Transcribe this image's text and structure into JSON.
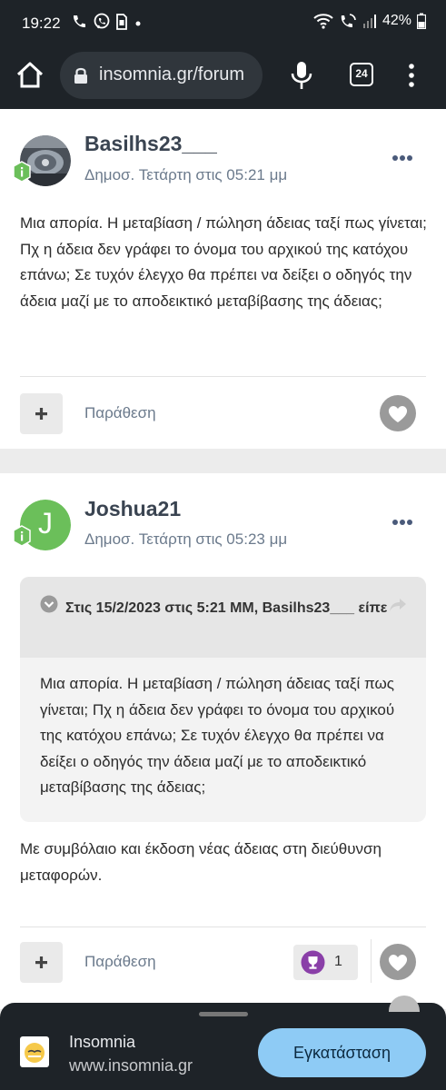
{
  "status_bar": {
    "time": "19:22",
    "battery": "42%"
  },
  "browser": {
    "url": "insomnia.gr/forum",
    "tab_count": "24"
  },
  "posts": [
    {
      "username": "Basilhs23___",
      "date": "Δημοσ. Τετάρτη στις 05:21 μμ",
      "body": "Μια απορία. Η μεταβίαση / πώληση άδειας ταξί πως γίνεται; Πχ η άδεια δεν γράφει το όνομα του αρχικού της κατόχου επάνω; Σε τυχόν έλεγχο θα πρέπει να δείξει ο οδηγός την άδεια μαζί με το αποδεικτικό μεταβίβασης της άδειας;",
      "quote_label": "Παράθεση"
    },
    {
      "username": "Joshua21",
      "avatar_letter": "J",
      "date": "Δημοσ. Τετάρτη στις 05:23 μμ",
      "quote_header": "Στις 15/2/2023 στις 5:21 ΜΜ, Basilhs23___ είπε",
      "quote_body": "Μια απορία. Η μεταβίαση / πώληση άδειας ταξί πως γίνεται; Πχ η άδεια δεν γράφει το όνομα του αρχικού της κατόχου επάνω; Σε τυχόν έλεγχο θα πρέπει να δείξει ο οδηγός την άδεια μαζί με το αποδεικτικό μεταβίβασης της άδειας;",
      "body": "Με συμβόλαιο και έκδοση νέας άδειας στη διεύθυνση μεταφορών.",
      "quote_label": "Παράθεση",
      "reaction_count": "1"
    }
  ],
  "install_sheet": {
    "app_name": "Insomnia",
    "app_url": "www.insomnia.gr",
    "button_label": "Εγκατάσταση"
  },
  "colors": {
    "browser_bg": "#1e2328",
    "accent_green": "#6bbf5a",
    "install_button": "#8ecbf5",
    "trophy_purple": "#8a3fa8"
  }
}
